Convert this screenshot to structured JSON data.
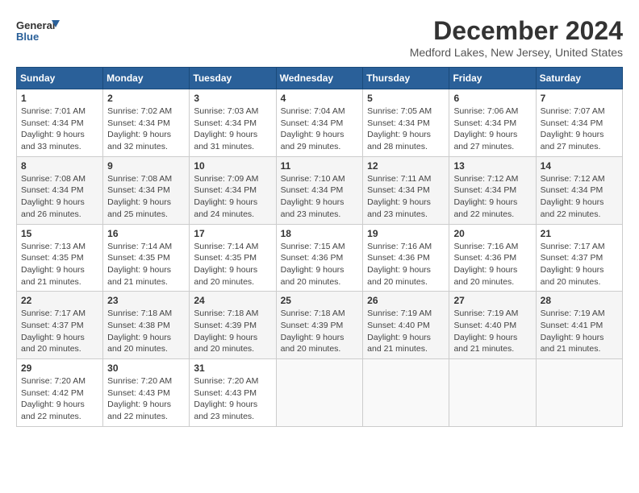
{
  "header": {
    "logo_line1": "General",
    "logo_line2": "Blue",
    "month": "December 2024",
    "location": "Medford Lakes, New Jersey, United States"
  },
  "weekdays": [
    "Sunday",
    "Monday",
    "Tuesday",
    "Wednesday",
    "Thursday",
    "Friday",
    "Saturday"
  ],
  "weeks": [
    [
      {
        "day": "1",
        "info": "Sunrise: 7:01 AM\nSunset: 4:34 PM\nDaylight: 9 hours and 33 minutes."
      },
      {
        "day": "2",
        "info": "Sunrise: 7:02 AM\nSunset: 4:34 PM\nDaylight: 9 hours and 32 minutes."
      },
      {
        "day": "3",
        "info": "Sunrise: 7:03 AM\nSunset: 4:34 PM\nDaylight: 9 hours and 31 minutes."
      },
      {
        "day": "4",
        "info": "Sunrise: 7:04 AM\nSunset: 4:34 PM\nDaylight: 9 hours and 29 minutes."
      },
      {
        "day": "5",
        "info": "Sunrise: 7:05 AM\nSunset: 4:34 PM\nDaylight: 9 hours and 28 minutes."
      },
      {
        "day": "6",
        "info": "Sunrise: 7:06 AM\nSunset: 4:34 PM\nDaylight: 9 hours and 27 minutes."
      },
      {
        "day": "7",
        "info": "Sunrise: 7:07 AM\nSunset: 4:34 PM\nDaylight: 9 hours and 27 minutes."
      }
    ],
    [
      {
        "day": "8",
        "info": "Sunrise: 7:08 AM\nSunset: 4:34 PM\nDaylight: 9 hours and 26 minutes."
      },
      {
        "day": "9",
        "info": "Sunrise: 7:08 AM\nSunset: 4:34 PM\nDaylight: 9 hours and 25 minutes."
      },
      {
        "day": "10",
        "info": "Sunrise: 7:09 AM\nSunset: 4:34 PM\nDaylight: 9 hours and 24 minutes."
      },
      {
        "day": "11",
        "info": "Sunrise: 7:10 AM\nSunset: 4:34 PM\nDaylight: 9 hours and 23 minutes."
      },
      {
        "day": "12",
        "info": "Sunrise: 7:11 AM\nSunset: 4:34 PM\nDaylight: 9 hours and 23 minutes."
      },
      {
        "day": "13",
        "info": "Sunrise: 7:12 AM\nSunset: 4:34 PM\nDaylight: 9 hours and 22 minutes."
      },
      {
        "day": "14",
        "info": "Sunrise: 7:12 AM\nSunset: 4:34 PM\nDaylight: 9 hours and 22 minutes."
      }
    ],
    [
      {
        "day": "15",
        "info": "Sunrise: 7:13 AM\nSunset: 4:35 PM\nDaylight: 9 hours and 21 minutes."
      },
      {
        "day": "16",
        "info": "Sunrise: 7:14 AM\nSunset: 4:35 PM\nDaylight: 9 hours and 21 minutes."
      },
      {
        "day": "17",
        "info": "Sunrise: 7:14 AM\nSunset: 4:35 PM\nDaylight: 9 hours and 20 minutes."
      },
      {
        "day": "18",
        "info": "Sunrise: 7:15 AM\nSunset: 4:36 PM\nDaylight: 9 hours and 20 minutes."
      },
      {
        "day": "19",
        "info": "Sunrise: 7:16 AM\nSunset: 4:36 PM\nDaylight: 9 hours and 20 minutes."
      },
      {
        "day": "20",
        "info": "Sunrise: 7:16 AM\nSunset: 4:36 PM\nDaylight: 9 hours and 20 minutes."
      },
      {
        "day": "21",
        "info": "Sunrise: 7:17 AM\nSunset: 4:37 PM\nDaylight: 9 hours and 20 minutes."
      }
    ],
    [
      {
        "day": "22",
        "info": "Sunrise: 7:17 AM\nSunset: 4:37 PM\nDaylight: 9 hours and 20 minutes."
      },
      {
        "day": "23",
        "info": "Sunrise: 7:18 AM\nSunset: 4:38 PM\nDaylight: 9 hours and 20 minutes."
      },
      {
        "day": "24",
        "info": "Sunrise: 7:18 AM\nSunset: 4:39 PM\nDaylight: 9 hours and 20 minutes."
      },
      {
        "day": "25",
        "info": "Sunrise: 7:18 AM\nSunset: 4:39 PM\nDaylight: 9 hours and 20 minutes."
      },
      {
        "day": "26",
        "info": "Sunrise: 7:19 AM\nSunset: 4:40 PM\nDaylight: 9 hours and 21 minutes."
      },
      {
        "day": "27",
        "info": "Sunrise: 7:19 AM\nSunset: 4:40 PM\nDaylight: 9 hours and 21 minutes."
      },
      {
        "day": "28",
        "info": "Sunrise: 7:19 AM\nSunset: 4:41 PM\nDaylight: 9 hours and 21 minutes."
      }
    ],
    [
      {
        "day": "29",
        "info": "Sunrise: 7:20 AM\nSunset: 4:42 PM\nDaylight: 9 hours and 22 minutes."
      },
      {
        "day": "30",
        "info": "Sunrise: 7:20 AM\nSunset: 4:43 PM\nDaylight: 9 hours and 22 minutes."
      },
      {
        "day": "31",
        "info": "Sunrise: 7:20 AM\nSunset: 4:43 PM\nDaylight: 9 hours and 23 minutes."
      },
      null,
      null,
      null,
      null
    ]
  ]
}
